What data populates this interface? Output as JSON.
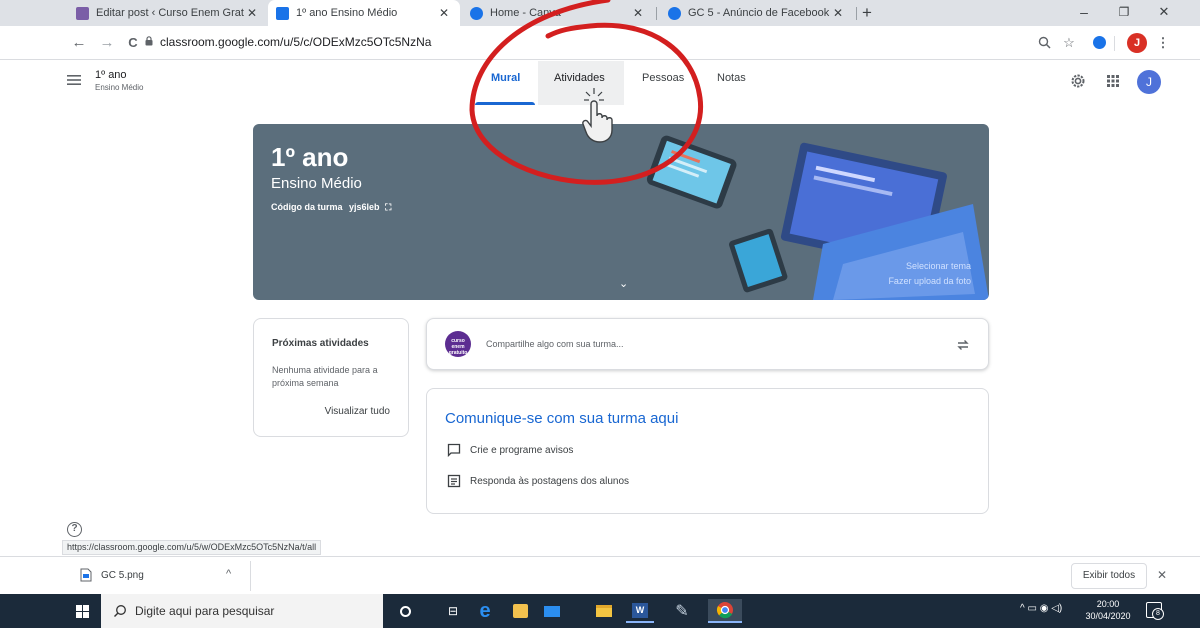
{
  "tabs": [
    {
      "title": "Editar post ‹ Curso Enem Gratuito",
      "close": "✕",
      "favicon_color": "#7b5ea7"
    },
    {
      "title": "1º ano Ensino Médio",
      "close": "✕",
      "favicon_color": "#1a73e8"
    },
    {
      "title": "Home - Canva",
      "close": "✕",
      "favicon_color": "#1a73e8"
    },
    {
      "title": "GC 5 - Anúncio de Facebook",
      "close": "✕",
      "favicon_color": "#1a73e8"
    }
  ],
  "new_tab": "+",
  "window_controls": {
    "minimize": "–",
    "restore": "❐",
    "close": "✕"
  },
  "toolbar": {
    "back": "←",
    "forward": "→",
    "reload": "C",
    "url": "classroom.google.com/u/5/c/ODExMzc5OTc5NzNa",
    "profile_initial": "J",
    "profile_color": "#d93025"
  },
  "classroom": {
    "menu_icon": "≡",
    "class_name": "1º ano",
    "class_section": "Ensino Médio",
    "tabs": [
      "Mural",
      "Atividades",
      "Pessoas",
      "Notas"
    ],
    "active_tab": "Mural",
    "avatar_initial": "J",
    "avatar_color": "#4f72d9"
  },
  "banner": {
    "title": "1º ano",
    "subtitle": "Ensino Médio",
    "code_label": "Código da turma",
    "code_value": "yjs6leb",
    "select_theme": "Selecionar tema",
    "upload_photo": "Fazer upload da foto",
    "bg_color": "#5b6e7c"
  },
  "upcoming": {
    "title": "Próximas atividades",
    "empty": "Nenhuma atividade para a próxima semana",
    "view_all": "Visualizar tudo"
  },
  "share": {
    "placeholder": "Compartilhe algo com sua turma...",
    "logo_text": "curso enem gratuito"
  },
  "communicate": {
    "title": "Comunique-se com sua turma aqui",
    "items": [
      "Crie e programe avisos",
      "Responda às postagens dos alunos"
    ]
  },
  "help_icon": "?",
  "status_url": "https://classroom.google.com/u/5/w/ODExMzc5OTc5NzNa/t/all",
  "downloads": {
    "file": "GC 5.png",
    "show_all": "Exibir todos",
    "close": "✕"
  },
  "taskbar": {
    "search_placeholder": "Digite aqui para pesquisar",
    "time": "20:00",
    "date": "30/04/2020",
    "notification_count": "8"
  },
  "annotation_color": "#d31f1f"
}
